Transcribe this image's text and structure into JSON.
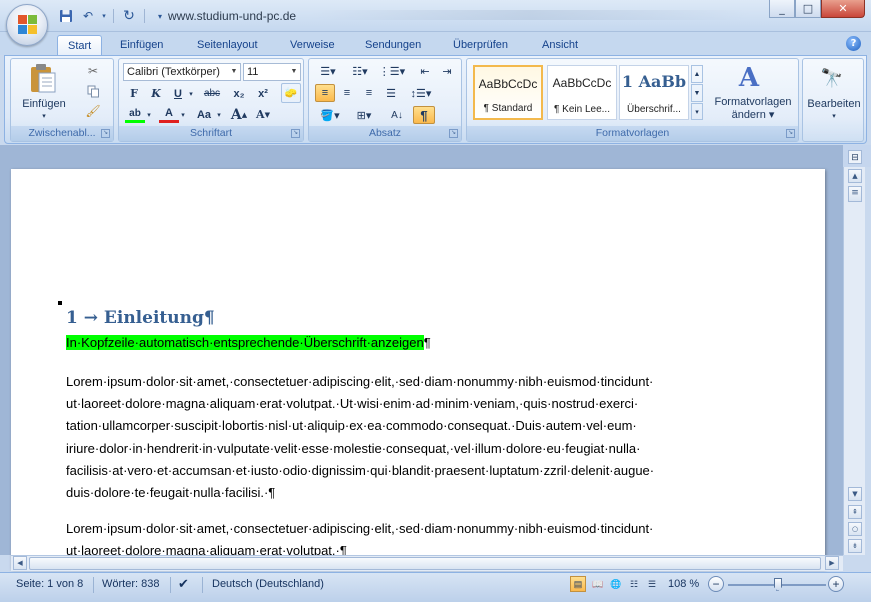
{
  "titlebar": {
    "title": "www.studium-und-pc.de",
    "minimize": "_",
    "maximize": "□",
    "close": "✕"
  },
  "tabs": [
    "Start",
    "Einfügen",
    "Seitenlayout",
    "Verweise",
    "Sendungen",
    "Überprüfen",
    "Ansicht"
  ],
  "ribbon": {
    "clipboard": {
      "paste": "Einfügen",
      "label": "Zwischenabl..."
    },
    "font": {
      "font_name": "Calibri (Textkörper)",
      "font_size": "11",
      "bold": "F",
      "italic": "K",
      "underline": "U",
      "strike": "abc",
      "subscript": "x₂",
      "superscript": "x²",
      "change_case": "Aa",
      "grow": "A",
      "shrink": "A",
      "label": "Schriftart"
    },
    "paragraph": {
      "pilcrow": "¶",
      "label": "Absatz"
    },
    "styles": {
      "items": [
        {
          "sample": "AaBbCcDc",
          "name": "¶ Standard"
        },
        {
          "sample": "AaBbCcDc",
          "name": "¶ Kein Lee..."
        },
        {
          "sample": "1  AaBb",
          "name": "Überschrif..."
        }
      ],
      "change_styles": "Formatvorlagen",
      "change_styles_2": "ändern ▾",
      "label": "Formatvorlagen"
    },
    "editing": {
      "label": "Bearbeiten"
    }
  },
  "document": {
    "heading": "1 → Einleitung¶",
    "highlighted": "In·Kopfzeile·automatisch·entsprechende·Überschrift·anzeigen",
    "highlighted_mark": "¶",
    "para1": [
      "Lorem·ipsum·dolor·sit·amet,·consectetuer·adipiscing·elit,·sed·diam·nonummy·nibh·euismod·tincidunt·",
      "ut·laoreet·dolore·magna·aliquam·erat·volutpat.·Ut·wisi·enim·ad·minim·veniam,·quis·nostrud·exerci·",
      "tation·ullamcorper·suscipit·lobortis·nisl·ut·aliquip·ex·ea·commodo·consequat.·Duis·autem·vel·eum·",
      "iriure·dolor·in·hendrerit·in·vulputate·velit·esse·molestie·consequat,·vel·illum·dolore·eu·feugiat·nulla·",
      "facilisis·at·vero·et·accumsan·et·iusto·odio·dignissim·qui·blandit·praesent·luptatum·zzril·delenit·augue·",
      "duis·dolore·te·feugait·nulla·facilisi.·¶"
    ],
    "para2": [
      "Lorem·ipsum·dolor·sit·amet,·consectetuer·adipiscing·elit,·sed·diam·nonummy·nibh·euismod·tincidunt·",
      "ut·laoreet·dolore·magna·aliquam·erat·volutpat.·¶"
    ]
  },
  "statusbar": {
    "page": "Seite: 1 von 8",
    "words": "Wörter: 838",
    "language": "Deutsch (Deutschland)",
    "zoom": "108 %",
    "zoom_percent": 108
  },
  "colors": {
    "accent": "#15428b",
    "heading": "#365f91",
    "highlight": "#00ff00"
  }
}
